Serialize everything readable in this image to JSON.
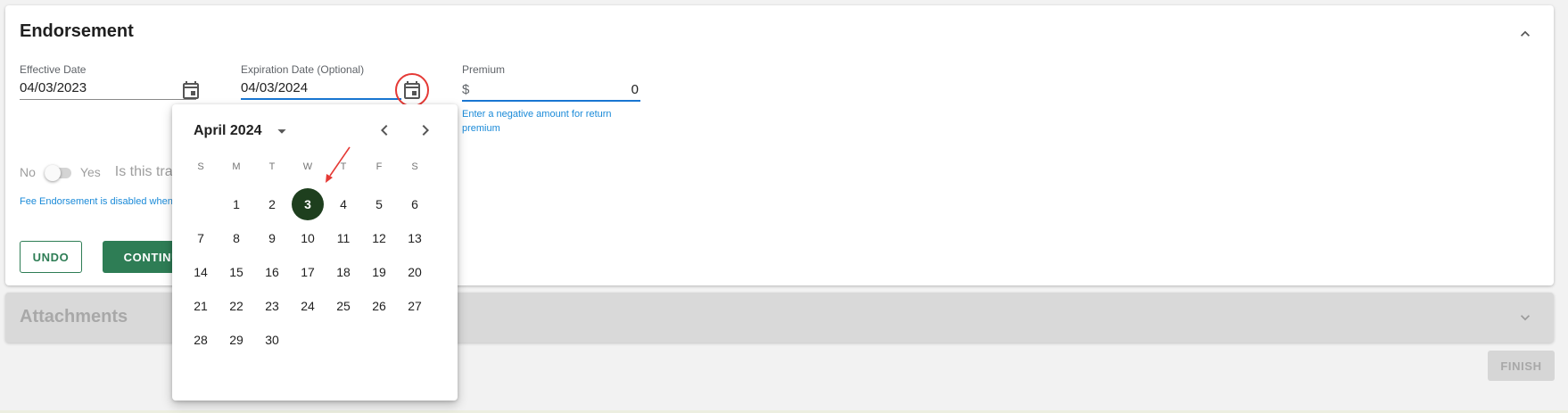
{
  "endorsement": {
    "title": "Endorsement",
    "effective_date": {
      "label": "Effective Date",
      "value": "04/03/2023"
    },
    "expiration_date": {
      "label": "Expiration Date (Optional)",
      "value": "04/03/2024"
    },
    "premium": {
      "label": "Premium",
      "currency": "$",
      "value": "0",
      "helper": "Enter a negative amount for return premium",
      "helper_line1": "Enter a negative amount for return",
      "helper_line2": "premium"
    },
    "toggle": {
      "off_label": "No",
      "on_label": "Yes",
      "state": "off"
    },
    "question": "Is this tra",
    "fee_note": "Fee Endorsement is disabled when",
    "undo_label": "UNDO",
    "continue_label": "CONTINUE"
  },
  "attachments": {
    "title": "Attachments"
  },
  "finish_label": "FINISH",
  "date_picker": {
    "month_label": "April 2024",
    "weekdays": [
      "S",
      "M",
      "T",
      "W",
      "T",
      "F",
      "S"
    ],
    "days": [
      "1",
      "2",
      "3",
      "4",
      "5",
      "6",
      "7",
      "8",
      "9",
      "10",
      "11",
      "12",
      "13",
      "14",
      "15",
      "16",
      "17",
      "18",
      "19",
      "20",
      "21",
      "22",
      "23",
      "24",
      "25",
      "26",
      "27",
      "28",
      "29",
      "30"
    ],
    "first_weekday_index": 1,
    "selected_day": "3"
  },
  "colors": {
    "primary_green": "#2e7d55",
    "selected_day": "#1e3f1e",
    "link_blue": "#1a8ad8",
    "focus_blue": "#1976d2",
    "annotation_red": "#e53935"
  },
  "icons": {
    "calendar": "calendar-icon",
    "collapse": "chevron-up-icon",
    "expand": "chevron-down-icon",
    "prev_month": "chevron-left-icon",
    "next_month": "chevron-right-icon",
    "month_dropdown": "caret-down-icon"
  }
}
